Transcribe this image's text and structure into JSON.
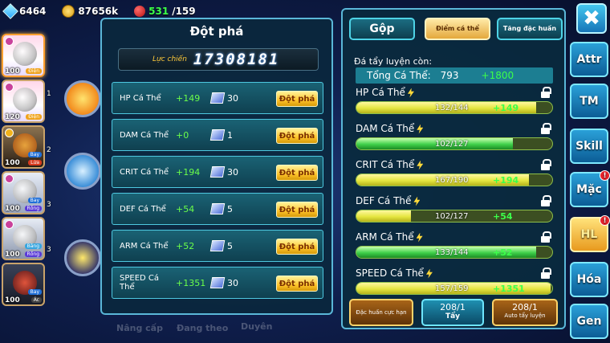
{
  "resources": {
    "gems": "6464",
    "gold": "87656k",
    "stamina_current": "531",
    "stamina_max": "/159"
  },
  "roster": [
    {
      "level": "100",
      "type": "Điện",
      "rank": ""
    },
    {
      "level": "120",
      "type": "Điện",
      "rank": "1"
    },
    {
      "level": "100",
      "type": "Bay",
      "type2": "Lửa",
      "rank": "2"
    },
    {
      "level": "100",
      "type": "Bay",
      "type2": "Rồng",
      "rank": "3"
    },
    {
      "level": "100",
      "type": "Băng",
      "type2": "Rồng",
      "rank": "3"
    },
    {
      "level": "100",
      "type": "Bay",
      "type2": "Ác",
      "rank": ""
    }
  ],
  "left_labels": {
    "upgrade": "Nâng cấp",
    "training": "Đang theo",
    "bond": "Duyên"
  },
  "breakthrough": {
    "title": "Đột phá",
    "power_label": "Lực chiến",
    "power_value": "17308181",
    "button_label": "Đột phá",
    "rows": [
      {
        "name": "HP Cá Thể",
        "bonus": "+149",
        "cost": "30"
      },
      {
        "name": "DAM Cá Thể",
        "bonus": "+0",
        "cost": "1"
      },
      {
        "name": "CRIT Cá Thể",
        "bonus": "+194",
        "cost": "30"
      },
      {
        "name": "DEF Cá Thể",
        "bonus": "+54",
        "cost": "5"
      },
      {
        "name": "ARM Cá Thể",
        "bonus": "+52",
        "cost": "5"
      },
      {
        "name": "SPEED Cá Thể",
        "bonus": "+1351",
        "cost": "30"
      }
    ]
  },
  "training": {
    "tabs": {
      "merge": "Gộp",
      "individual": "Điểm cá thể",
      "special": "Tăng đặc huấn"
    },
    "remaining_label": "Đá tẩy luyện còn:",
    "total_label": "Tổng Cá Thể:",
    "total_value": "793",
    "total_bonus": "+1800",
    "stats": [
      {
        "name": "HP Cá Thể",
        "value": "132/144",
        "bonus": "+149",
        "fill": 0.92,
        "color": "yellow"
      },
      {
        "name": "DAM Cá Thể",
        "value": "102/127",
        "bonus": "",
        "fill": 0.8,
        "color": "green"
      },
      {
        "name": "CRIT Cá Thể",
        "value": "167/190",
        "bonus": "+194",
        "fill": 0.88,
        "color": "yellow"
      },
      {
        "name": "DEF Cá Thể",
        "value": "102/127",
        "bonus": "+54",
        "fill": 0.28,
        "color": "yellow"
      },
      {
        "name": "ARM Cá Thể",
        "value": "133/144",
        "bonus": "+52",
        "fill": 0.92,
        "color": "green"
      },
      {
        "name": "SPEED Cá Thể",
        "value": "157/159",
        "bonus": "+1351",
        "fill": 0.99,
        "color": "yellow"
      }
    ],
    "buttons": {
      "special_training": "Đặc huấn cực hạn",
      "wash_count": "208/1",
      "wash_label": "Tẩy",
      "auto_count": "208/1",
      "auto_label": "Auto tẩy luyện"
    }
  },
  "side_menu": [
    {
      "label": "Attr",
      "badge": ""
    },
    {
      "label": "TM",
      "badge": ""
    },
    {
      "label": "Skill",
      "badge": ""
    },
    {
      "label": "Mặc",
      "badge": "!"
    },
    {
      "label": "HL",
      "badge": "!"
    },
    {
      "label": "Hóa",
      "badge": ""
    },
    {
      "label": "Gen",
      "badge": ""
    }
  ],
  "close_label": "✖"
}
